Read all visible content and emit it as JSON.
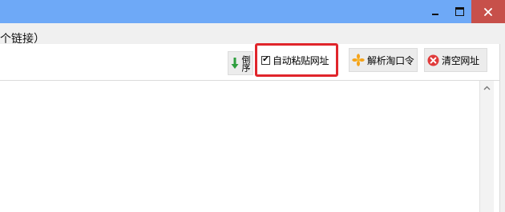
{
  "window": {
    "controls": {
      "minimize_icon": "minimize-icon",
      "maximize_icon": "maximize-icon",
      "close_icon": "close-icon"
    },
    "titlebar_color": "#6ea9f7",
    "close_color": "#c7504a"
  },
  "toolbar": {
    "header_text": "个链接）",
    "reverse_label": "倒序",
    "reverse_icon": "down-arrow-icon",
    "auto_paste_label": "自动粘贴网址",
    "auto_paste_checked": true,
    "highlight_color": "#e0252b",
    "parse_label": "解析淘口令",
    "parse_icon": "sparkle-icon",
    "clear_label": "清空网址",
    "clear_icon": "clear-circle-icon"
  }
}
